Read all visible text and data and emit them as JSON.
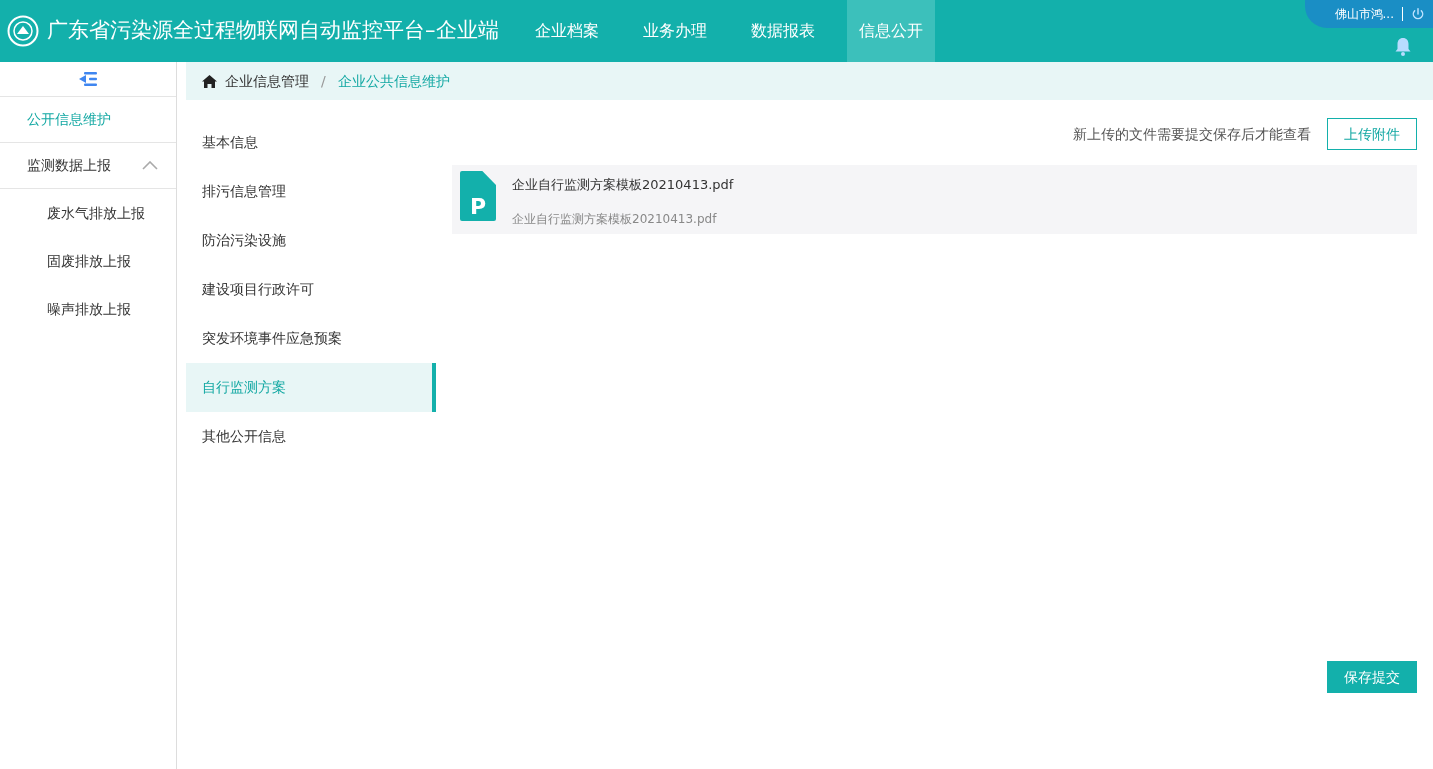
{
  "header": {
    "title": "广东省污染源全过程物联网自动监控平台–企业端",
    "nav": [
      {
        "label": "企业档案",
        "selected": false
      },
      {
        "label": "业务办理",
        "selected": false
      },
      {
        "label": "数据报表",
        "selected": false
      },
      {
        "label": "信息公开",
        "selected": true
      }
    ],
    "user": "佛山市鸿..."
  },
  "sidebar": {
    "items": [
      {
        "kind": "link",
        "label": "公开信息维护",
        "selected": true
      },
      {
        "kind": "group",
        "label": "监测数据上报",
        "expanded": true,
        "children": [
          {
            "label": "废水气排放上报",
            "selected": false
          },
          {
            "label": "固废排放上报",
            "selected": false
          },
          {
            "label": "噪声排放上报",
            "selected": false
          }
        ]
      }
    ]
  },
  "breadcrumb": [
    "企业信息管理",
    "企业公共信息维护"
  ],
  "breadcrumb_separator": "/",
  "tabs": [
    {
      "label": "基本信息",
      "selected": false
    },
    {
      "label": "排污信息管理",
      "selected": false
    },
    {
      "label": "防治污染设施",
      "selected": false
    },
    {
      "label": "建设项目行政许可",
      "selected": false
    },
    {
      "label": "突发环境事件应急预案",
      "selected": false
    },
    {
      "label": "自行监测方案",
      "selected": true
    },
    {
      "label": "其他公开信息",
      "selected": false
    }
  ],
  "notice": "新上传的文件需要提交保存后才能查看",
  "upload_button": "上传附件",
  "files": [
    {
      "icon_letter": "P",
      "name": "企业自行监测方案模板20210413.pdf",
      "subtitle": "企业自行监测方案模板20210413.pdf"
    }
  ],
  "submit_button": "保存提交"
}
